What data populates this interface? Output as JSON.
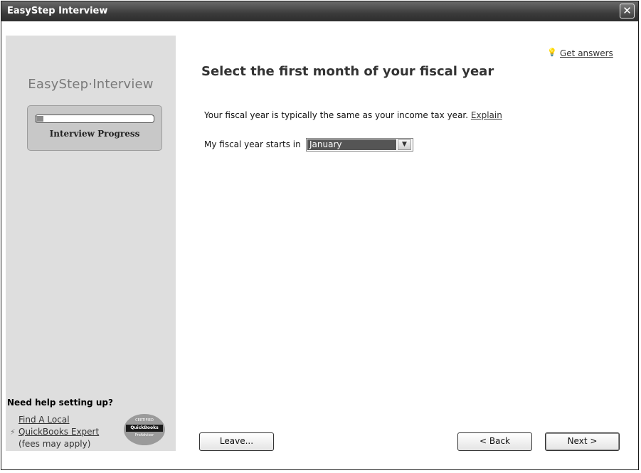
{
  "window": {
    "title": "EasyStep Interview",
    "close_icon": "close-icon"
  },
  "sidebar": {
    "brand": "EasyStep·Interview",
    "progress": {
      "label": "Interview Progress",
      "fraction": 0.06
    },
    "help": {
      "heading": "Need help setting up?",
      "link_line1": "Find A Local",
      "link_line2": "QuickBooks Expert",
      "note": "(fees may apply)",
      "badge": {
        "top": "CERTIFIED",
        "middle": "QuickBooks",
        "bottom": "ProAdvisor"
      }
    }
  },
  "main": {
    "get_answers": "Get answers",
    "title": "Select the first month of your fiscal year",
    "intro_text": "Your fiscal year is typically the same as your income tax year. ",
    "intro_link": "Explain",
    "field_label": "My fiscal year starts in",
    "fiscal_month": "January"
  },
  "footer": {
    "leave": "Leave...",
    "back": "< Back",
    "next": "Next >"
  }
}
